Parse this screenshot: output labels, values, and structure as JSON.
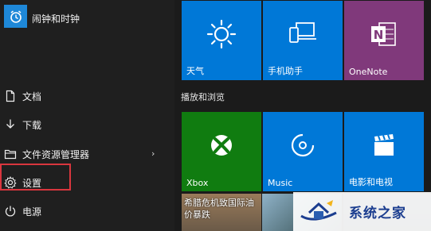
{
  "app_list": {
    "items": [
      {
        "label": "闹钟和时钟",
        "icon": "alarm-clock-icon"
      }
    ]
  },
  "nav": {
    "items": [
      {
        "label": "文档",
        "icon": "document-icon"
      },
      {
        "label": "下载",
        "icon": "download-icon"
      },
      {
        "label": "文件资源管理器",
        "icon": "folder-icon",
        "has_submenu": true,
        "chevron": "›"
      },
      {
        "label": "设置",
        "icon": "gear-icon",
        "highlighted": true
      },
      {
        "label": "电源",
        "icon": "power-icon"
      }
    ]
  },
  "tiles": {
    "weather": {
      "label": "天气",
      "icon": "sun-icon",
      "color": "#0078d7"
    },
    "phone": {
      "label": "手机助手",
      "icon": "phone-laptop-icon",
      "color": "#0078d7"
    },
    "onenote": {
      "label": "OneNote",
      "icon": "onenote-icon",
      "glyph": "N",
      "color": "#80397b"
    },
    "group_label": "播放和浏览",
    "xbox": {
      "label": "Xbox",
      "icon": "xbox-icon",
      "color": "#107c10"
    },
    "music": {
      "label": "Music",
      "icon": "music-disc-icon",
      "color": "#0078d7"
    },
    "movies": {
      "label": "电影和电视",
      "icon": "clapperboard-icon",
      "color": "#0078d7"
    },
    "news": {
      "text": "希腊危机致国际油价暴跌"
    }
  },
  "watermark": {
    "text": "系统之家",
    "color": "#1b3d8f"
  },
  "highlight_color": "#d9363e"
}
